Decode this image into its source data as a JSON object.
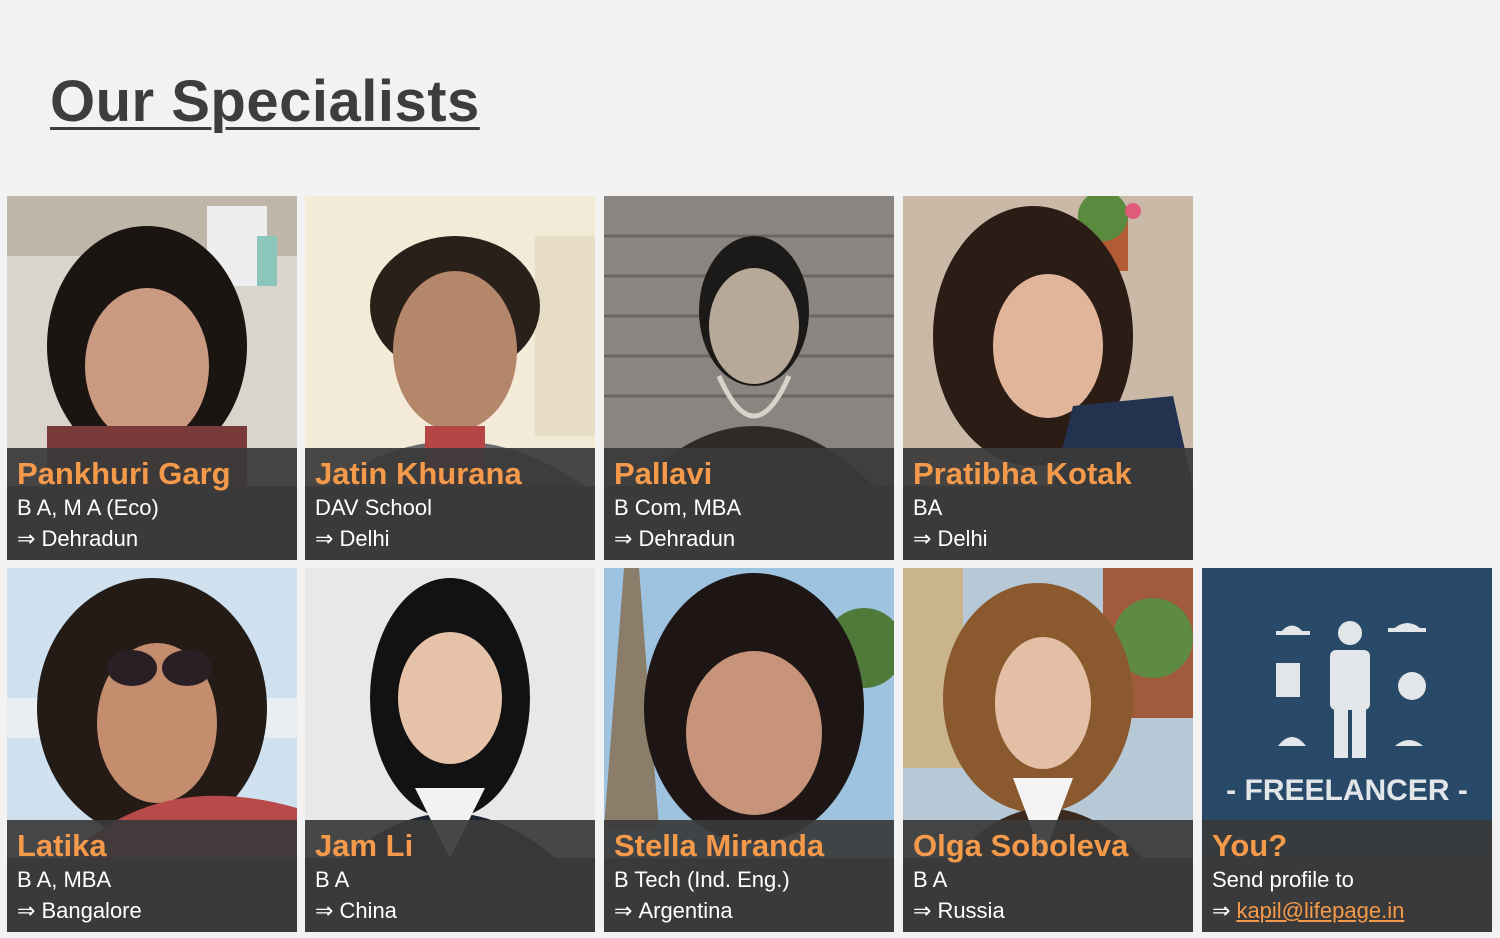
{
  "header": {
    "title": "Our Specialists"
  },
  "colors": {
    "accent": "#f59a4a",
    "caption_bg": "#3a3a3a",
    "page_bg": "#f2f2f2"
  },
  "arrow_glyph": "⇒",
  "specialists": [
    {
      "name": "Pankhuri Garg",
      "qualification": "B A, M A (Eco)",
      "location": "Dehradun",
      "photo": "woman-dark-hair-portrait"
    },
    {
      "name": "Jatin Khurana",
      "qualification": "DAV School",
      "location": "Delhi",
      "photo": "man-smiling-portrait"
    },
    {
      "name": "Pallavi",
      "qualification": "B Com, MBA",
      "location": "Dehradun",
      "photo": "woman-brick-wall-bw-portrait"
    },
    {
      "name": "Pratibha Kotak",
      "qualification": "BA",
      "location": "Delhi",
      "photo": "woman-keep-calm-shirt-portrait"
    },
    {
      "name": "Latika",
      "qualification": "B A, MBA",
      "location": "Bangalore",
      "photo": "woman-sunglasses-portrait"
    },
    {
      "name": "Jam Li",
      "qualification": "B A",
      "location": "China",
      "photo": "girl-black-hair-portrait"
    },
    {
      "name": "Stella Miranda",
      "qualification": "B Tech (Ind. Eng.)",
      "location": "Argentina",
      "photo": "woman-eiffel-tower-portrait"
    },
    {
      "name": "Olga Soboleva",
      "qualification": "B A",
      "location": "Russia",
      "photo": "woman-city-canal-portrait"
    }
  ],
  "cta": {
    "name": "You?",
    "line1": "Send profile to",
    "email": "kapil@lifepage.in",
    "badge_text": "- FREELANCER -",
    "photo": "freelancer-icon-board"
  }
}
